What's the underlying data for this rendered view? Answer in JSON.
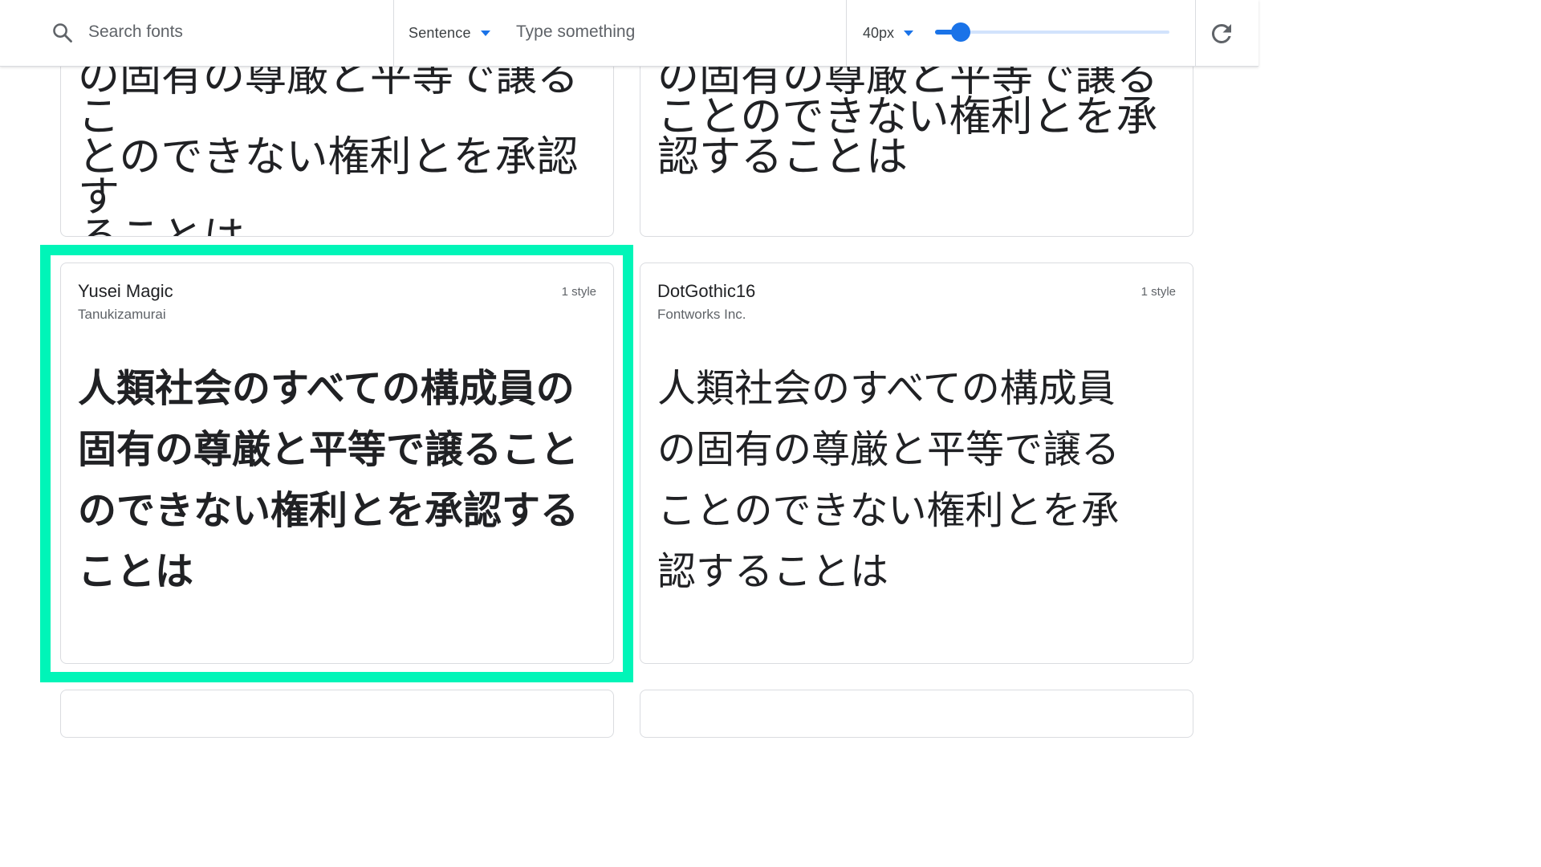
{
  "toolbar": {
    "search_placeholder": "Search fonts",
    "mode_label": "Sentence",
    "type_placeholder": "Type something",
    "size_label": "40px",
    "size_slider_fraction": 0.11,
    "accent_color": "#1a73e8"
  },
  "cards": [
    {
      "sample": "の固有の尊厳と平等で譲るこ\nとのできない権利とを承認す\nることは"
    },
    {
      "sample": "の固有の尊厳と平等で譲る\nことのできない権利とを承\n認することは"
    },
    {
      "name": "Yusei Magic",
      "author": "Tanukizamurai",
      "styles": "1 style",
      "sample": "人類社会のすべての構成員の\n固有の尊厳と平等で譲ること\nのできない権利とを承認する\nことは"
    },
    {
      "name": "DotGothic16",
      "author": "Fontworks Inc.",
      "styles": "1 style",
      "sample": "人類社会のすべての構成員\nの固有の尊厳と平等で譲る\nことのできない権利とを承\n認することは"
    }
  ],
  "highlight_color": "#00f5b8"
}
